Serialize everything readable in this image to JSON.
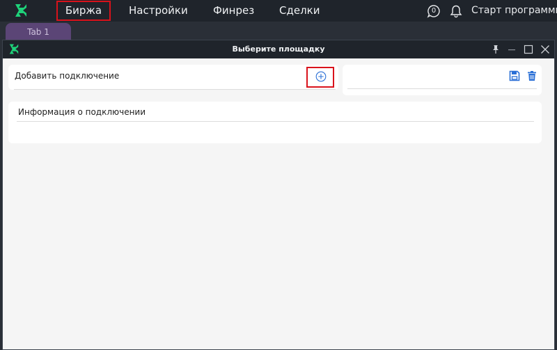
{
  "menu": {
    "items": [
      {
        "label": "Биржа",
        "highlighted": true
      },
      {
        "label": "Настройки"
      },
      {
        "label": "Финрез"
      },
      {
        "label": "Сделки"
      }
    ],
    "notification_count": "0",
    "start_label": "Старт программы"
  },
  "tabs": [
    {
      "label": "Tab 1"
    }
  ],
  "dialog": {
    "title": "Выберите площадку",
    "add_connection_label": "Добавить подключение",
    "connection_info_label": "Информация о подключении"
  },
  "colors": {
    "accent_green": "#1ed37a",
    "highlight_red": "#d9121b",
    "icon_blue": "#2a6fd6",
    "tab_purple": "#5b4576"
  },
  "icons": {
    "logo": "app-logo-icon",
    "notifications": "chat-bubble-icon",
    "bell": "bell-icon",
    "add": "plus-circle-icon",
    "save": "floppy-disk-icon",
    "delete": "trash-icon",
    "pin": "pin-icon",
    "minimize": "minimize-icon",
    "maximize": "maximize-icon",
    "close": "close-icon"
  }
}
